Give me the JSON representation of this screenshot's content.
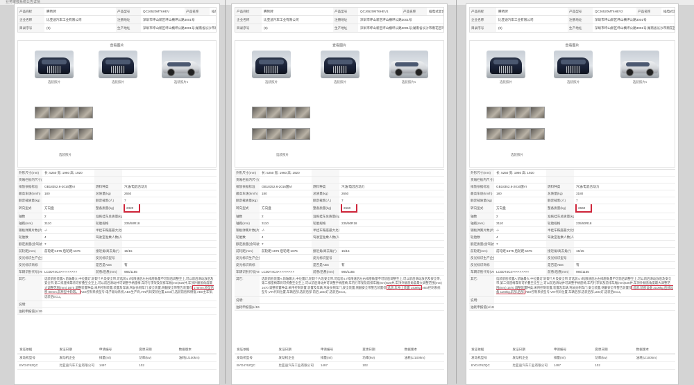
{
  "header": {
    "breadcrumb": "业务审核系统公告详情"
  },
  "pages": [
    {
      "id": "p1",
      "top_rows": [
        {
          "label": "产品商标",
          "value": "腾势牌",
          "label2": "产品型号",
          "value2": "QCJ6520MT6HEV",
          "label3": "产品名称",
          "value3": "插电式混合动力多用途乘用车"
        },
        {
          "label": "企业名称",
          "value": "比亚迪汽车工业有限公司",
          "label2": "注册地址",
          "value2": "深圳市坪山新区坪山横坪公路3001号"
        },
        {
          "label": "目录序号",
          "value": "(9)",
          "label2": "生产地址",
          "value2": "深圳市坪山新区坪山横坪公路3001号;湖南省长沙市雨花区环保东路88号"
        }
      ],
      "photos": {
        "title": "查看图片",
        "front_caption": "选装照片",
        "side_caption": "选装照片1",
        "interior_caption": "选装照片"
      },
      "spec_rows": [
        [
          "外形尺寸(mm)",
          "长: 5250 宽: 1960 高: 1920",
          "",
          ""
        ],
        [
          "货厢栏板内尺寸(mm)",
          "",
          "",
          ""
        ],
        [
          "排放依据标准",
          "GB18352.6-2016国VI",
          "燃料种类",
          "汽油/电混合动力"
        ],
        [
          "最高车速(km/h)",
          "180",
          "总质量(kg)",
          "2650"
        ],
        [
          "额定载质量(kg)",
          "",
          "额定载客(人)",
          "7"
        ],
        [
          "转向型式",
          "方向盘",
          "整备质量(kg)",
          "2320"
        ],
        [
          "轴数",
          "2",
          "准拖挂车总质量(kg)",
          ""
        ],
        [
          "轴距(mm)",
          "3110",
          "轮胎规格",
          "235/50R18"
        ],
        [
          "钢板弹簧片数(片)",
          "-/-",
          "半挂车鞍座最大允许承载质量(kg)",
          ""
        ],
        [
          "轮胎数",
          "4",
          "驾驶室准乘人数(人)",
          ""
        ],
        [
          "额定质量(含驾驶员)(前进/后退)",
          "7",
          "",
          ""
        ],
        [
          "前轮距(mm)",
          "前轮距:1675 后轮距:1675",
          "接近角/离去角(°)",
          "15/15"
        ],
        [
          "反光标识生产企业",
          "",
          "反光标识型号",
          ""
        ],
        [
          "反光标识商标",
          "",
          "是否是ABS",
          "有"
        ],
        [
          "车辆识别代号(VIN)",
          "LC0DT4C4×××××××××",
          "前悬/后悬(mm)",
          "985/1155"
        ]
      ],
      "other_label": "其它:",
      "other_text": "选装前脸装置A,前轴最大,中位置灯,轮毂个片及安全带,可选装4.7吨限速后左右排座数量不可前后调整至上,可以前后滑动放后及安全带,第二排座椅靠背可折叠至全至上,可以前后滑动并可调整手柄座椅,车内行李架及前排车厢(mm)625并,车顶外翻盖角度最大调整范围(mm) 1670 调整装置种类:采用控制装置,装置及车辆,驾驶员侧车门,安全装置,侧翻安全带警告装置仅",
      "other_highlight": "170mm,原型后移 80mm,前原型中轮毂。",
      "other_tail": "ABS控制系统型号:电子驱动系统,ABS生产商,VIN代码安装位置,LED灯,选装前脸和侧窗,ABS主车架,选装后ECU。",
      "note_label": "说明:",
      "fuel_label": "油耗申报值(L/100km)",
      "bottom_headers": [
        "发动机型号",
        "发动机企业",
        "排量(ml)",
        "功率(kw)",
        "油耗(L/100km)"
      ],
      "bottom_values": [
        "BYD476ZQC",
        "比亚迪汽车工业有限公司",
        "1497",
        "102",
        ""
      ],
      "bottom_label_row": [
        "发证依据",
        "发证日期",
        "申请编号",
        "变更日期",
        "数据版本"
      ]
    },
    {
      "id": "p2",
      "top_rows": [
        {
          "label": "产品商标",
          "value": "腾势牌",
          "label2": "产品型号",
          "value2": "QCJ6520MT6HEV1",
          "label3": "产品名称",
          "value3": "插电式混合动力多用途乘用车"
        },
        {
          "label": "企业名称",
          "value": "比亚迪汽车工业有限公司",
          "label2": "注册地址",
          "value2": "深圳市坪山新区坪山横坪公路3001号"
        },
        {
          "label": "目录序号",
          "value": "(9)",
          "label2": "生产地址",
          "value2": "深圳市坪山新区坪山横坪公路3001号;湖南省长沙市雨花区环保东路88号"
        }
      ],
      "photos": {
        "title": "查看图片",
        "front_caption": "选装照片",
        "side_caption": "选装照片1",
        "interior_caption": "选装照片"
      },
      "spec_rows": [
        [
          "外形尺寸(mm)",
          "长: 5250 宽: 1960 高: 1920",
          "",
          ""
        ],
        [
          "货厢栏板内尺寸(mm)",
          "",
          "",
          ""
        ],
        [
          "排放依据标准",
          "GB18352.6-2016国VI",
          "燃料种类",
          "汽油/电混合动力"
        ],
        [
          "最高车速(km/h)",
          "180",
          "总质量(kg)",
          "2650"
        ],
        [
          "额定载质量(kg)",
          "",
          "额定载客(人)",
          "7"
        ],
        [
          "转向型式",
          "方向盘",
          "整备质量(kg)",
          "2660"
        ],
        [
          "轴数",
          "2",
          "准拖挂车总质量(kg)",
          ""
        ],
        [
          "轴距(mm)",
          "3110",
          "轮胎规格",
          "235/50R18"
        ],
        [
          "钢板弹簧片数(片)",
          "-/-",
          "半挂车鞍座最大允许承载质量(kg)",
          ""
        ],
        [
          "轮胎数",
          "4",
          "驾驶室准乘人数(人)",
          ""
        ],
        [
          "额定质量(含驾驶员)(前进/后退)",
          "7",
          "",
          ""
        ],
        [
          "前轮距(mm)",
          "前轮距:1675 后轮距:1675",
          "接近角/离去角(°)",
          "15/15"
        ],
        [
          "反光标识生产企业",
          "",
          "反光标识型号",
          ""
        ],
        [
          "反光标识商标",
          "",
          "是否是ABS",
          "有"
        ],
        [
          "车辆识别代号(VIN)",
          "LC0DT4C4×××××××××",
          "前悬/后悬(mm)",
          "985/1155"
        ]
      ],
      "other_label": "其它:",
      "other_text": "选装前脸装置A,前轴最大,中位置灯,轮毂个片及安全带,可选装4.7吨限速后左右排座数量不可前后调整至上,可以前后滑动放后及安全带,第二排座椅靠背可折叠至全至上,可以前后滑动并可调整手柄座椅,车内行李架及前排车厢(mm)625并,车顶外翻盖角度最大调整范围(mm) 1670 调整装置种类:采用控制装置,装置及车辆,驾驶员侧车门,安全装置,侧翻安全带警告装置仅",
      "other_highlight": "选装,车身上装置 1438kg",
      "other_tail": "ABS控制系统型号,VIN代码位置,车辆后部,选装后部 前后,LED灯,选装后ECU。",
      "note_label": "说明:",
      "fuel_label": "油耗申报值(L/100km)",
      "bottom_headers": [
        "发动机型号",
        "发动机企业",
        "排量(ml)",
        "功率(kw)",
        "油耗(L/100km)"
      ],
      "bottom_values": [
        "BYD476ZQC",
        "比亚迪汽车工业有限公司",
        "1497",
        "102",
        ""
      ],
      "bottom_label_row": [
        "发证依据",
        "发证日期",
        "申请编号",
        "变更日期",
        "数据版本"
      ]
    },
    {
      "id": "p3",
      "top_rows": [
        {
          "label": "产品商标",
          "value": "腾势牌",
          "label2": "产品型号",
          "value2": "QCJ6520MT6HEV2",
          "label3": "产品名称",
          "value3": "插电式混合动力多用途乘用车"
        },
        {
          "label": "企业名称",
          "value": "比亚迪汽车工业有限公司",
          "label2": "注册地址",
          "value2": "深圳市坪山新区坪山横坪公路3001号"
        },
        {
          "label": "目录序号",
          "value": "(9)",
          "label2": "生产地址",
          "value2": "深圳市坪山新区坪山横坪公路3001号;湖南省长沙市雨花区环保东路88号"
        }
      ],
      "photos": {
        "title": "查看图片",
        "front_caption": "选装照片",
        "side_caption": "选装照片1",
        "interior_caption": "选装照片"
      },
      "spec_rows": [
        [
          "外形尺寸(mm)",
          "长: 5250 宽: 1960 高: 1920",
          "",
          ""
        ],
        [
          "货厢栏板内尺寸(mm)",
          "",
          "",
          ""
        ],
        [
          "排放依据标准",
          "GB18352.6-2016国VI",
          "燃料种类",
          "汽油/电混合动力"
        ],
        [
          "最高车速(km/h)",
          "180",
          "总质量(kg)",
          "3180"
        ],
        [
          "额定载质量(kg)",
          "",
          "额定载客(人)",
          "7"
        ],
        [
          "转向型式",
          "方向盘",
          "整备质量(kg)",
          "2660"
        ],
        [
          "轴数",
          "2",
          "准拖挂车总质量(kg)",
          ""
        ],
        [
          "轴距(mm)",
          "3110",
          "轮胎规格",
          "235/50R18"
        ],
        [
          "钢板弹簧片数(片)",
          "-/-",
          "半挂车鞍座最大允许承载质量(kg)",
          ""
        ],
        [
          "轮胎数",
          "4",
          "驾驶室准乘人数(人)",
          ""
        ],
        [
          "额定质量(含驾驶员)(前进/后退)",
          "7",
          "",
          ""
        ],
        [
          "前轮距(mm)",
          "前轮距:1675 后轮距:1675",
          "接近角/离去角(°)",
          "15/15"
        ],
        [
          "反光标识生产企业",
          "",
          "反光标识型号",
          ""
        ],
        [
          "反光标识商标",
          "",
          "是否是ABS",
          "有"
        ],
        [
          "车辆识别代号(VIN)",
          "LC0DT4C4×××××××××",
          "前悬/后悬(mm)",
          "985/1155"
        ]
      ],
      "other_label": "其它:",
      "other_text": "选装前脸装置A,前轴最大,中位置灯,轮毂个片及安全带,可选装4.7吨限速后左右排座数量不可前后调整至上,可以前后滑动放后及安全带,第二排座椅靠背可折叠至全至上,可以前后滑动并可调整手柄座椅,车内行李架及前排车厢(mm)625并,车顶外翻盖角度最大调整范围(mm) 1670 调整装置种类:采用控制装置,装置及车辆,驾驶员侧车门,安全装置,侧翻安全带警告装置仅",
      "other_highlight": "选装,前部设备 3100kg,后部设备 1100kg,前部,后部",
      "other_tail": "ABS控制系统型号,VIN代码位置,车辆后部,选装后部,LED灯,选装后ECU。",
      "note_label": "说明:",
      "fuel_label": "油耗申报值(L/100km)",
      "bottom_headers": [
        "发动机型号",
        "发动机企业",
        "排量(ml)",
        "功率(kw)",
        "油耗(L/100km)"
      ],
      "bottom_values": [
        "BYD476ZQC",
        "比亚迪汽车工业有限公司",
        "1497",
        "102",
        ""
      ],
      "bottom_label_row": [
        "发证依据",
        "发证日期",
        "申请编号",
        "变更日期",
        "数据版本"
      ]
    }
  ],
  "highlight_color": "#d0253a"
}
